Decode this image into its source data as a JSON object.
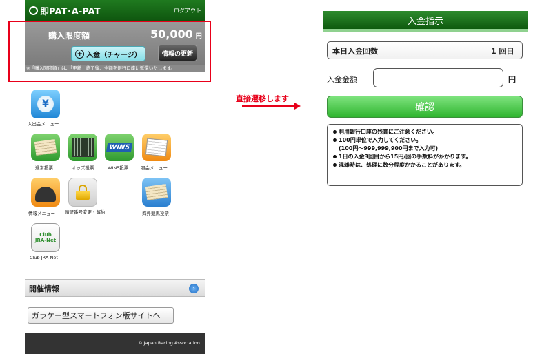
{
  "left": {
    "header": {
      "logo": "即PAT･A-PAT",
      "logout": "ログアウト"
    },
    "limit": {
      "label": "購入限度額",
      "value": "50,000",
      "unit": "円"
    },
    "buttons": {
      "deposit": "入金（チャージ）",
      "deposit_icon": "plus-circle-icon",
      "refresh": "情報の更新"
    },
    "note": "※「購入限度額」は、「更新」終了後、全額を銀行口座に返還いたします。",
    "menu": {
      "row1": [
        {
          "label": "入出金メニュー",
          "icon": "yen-icon"
        }
      ],
      "row2": [
        {
          "label": "通常投票",
          "icon": "ticket-icon"
        },
        {
          "label": "オッズ投票",
          "icon": "odds-icon"
        },
        {
          "label": "WIN5投票",
          "icon": "win5-icon"
        },
        {
          "label": "照会メニュー",
          "icon": "inquiry-icon"
        }
      ],
      "row3": [
        {
          "label": "情報メニュー",
          "icon": "helmet-icon"
        },
        {
          "label": "暗証番号変更・解約",
          "icon": "lock-icon"
        },
        {
          "label": "海外競馬投票",
          "icon": "overseas-ticket-icon"
        }
      ],
      "row4": [
        {
          "label": "Club JRA-Net",
          "icon": "club-jra-net-icon",
          "icon_text": "Club JRA-Net"
        }
      ]
    },
    "section": {
      "title": "開催情報",
      "arrow_icon": "chevron-right-icon"
    },
    "sp_link": "ガラケー型スマートフォン版サイトへ",
    "footer": "© Japan Racing Association."
  },
  "arrow": {
    "label": "直接遷移します"
  },
  "right": {
    "header": "入金指示",
    "count": {
      "label": "本日入金回数",
      "value": "1 回目"
    },
    "amount": {
      "label": "入金金額",
      "value": "",
      "unit": "円"
    },
    "confirm": "確認",
    "notes": [
      {
        "text": "利用銀行口座の残高にご注意ください。",
        "bullet": true
      },
      {
        "text": "100円単位で入力してください。",
        "bullet": true
      },
      {
        "text": "(100円～999,999,900円まで入力可)",
        "bullet": false
      },
      {
        "text": "1日の入金3回目から15円/回の手数料がかかります。",
        "bullet": true
      },
      {
        "text": "混雑時は、処理に数分程度かかることがあります。",
        "bullet": true
      }
    ]
  },
  "colors": {
    "accent_green": "#0f560f",
    "highlight_red": "#e8001a",
    "button_cyan": "#86dfe8",
    "confirm_green": "#2fb52f"
  }
}
